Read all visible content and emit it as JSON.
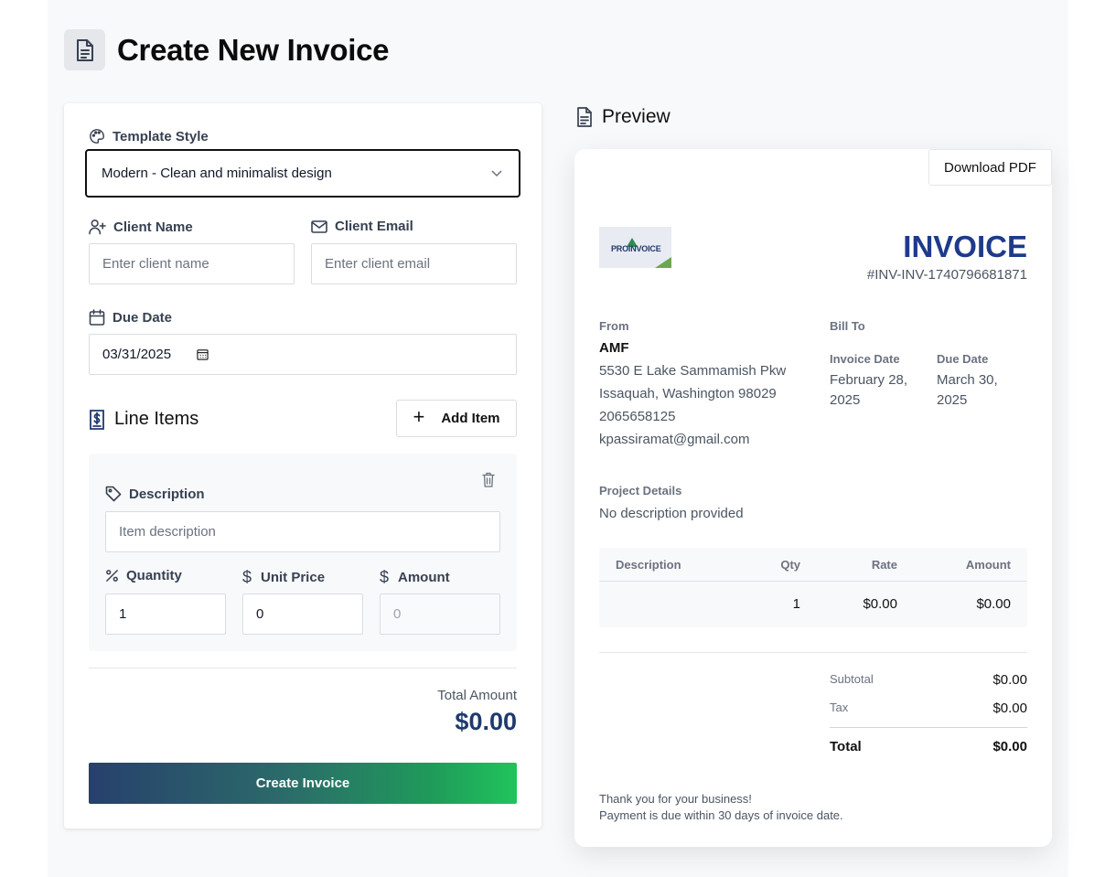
{
  "page": {
    "title": "Create New Invoice"
  },
  "form": {
    "template_style": {
      "label": "Template Style",
      "value": "Modern - Clean and minimalist design"
    },
    "client_name": {
      "label": "Client Name",
      "placeholder": "Enter client name"
    },
    "client_email": {
      "label": "Client Email",
      "placeholder": "Enter client email"
    },
    "due_date": {
      "label": "Due Date",
      "value": "03/31/2025"
    },
    "line_items": {
      "title": "Line Items",
      "add_label": "Add Item",
      "item": {
        "description_label": "Description",
        "description_placeholder": "Item description",
        "quantity_label": "Quantity",
        "quantity_value": "1",
        "unit_price_label": "Unit Price",
        "unit_price_value": "0",
        "amount_label": "Amount",
        "amount_value": "0"
      }
    },
    "total_label": "Total Amount",
    "total_value": "$0.00",
    "submit_label": "Create Invoice"
  },
  "preview": {
    "title": "Preview",
    "download_label": "Download PDF",
    "logo_text": "PROINVOICE",
    "invoice_title": "INVOICE",
    "invoice_number": "#INV-INV-1740796681871",
    "from_label": "From",
    "from_name": "AMF",
    "from_address1": "5530 E Lake Sammamish Pkw",
    "from_address2": "Issaquah, Washington 98029",
    "from_phone": "2065658125",
    "from_email": "kpassiramat@gmail.com",
    "bill_to_label": "Bill To",
    "invoice_date_label": "Invoice Date",
    "invoice_date_line1": "February 28,",
    "invoice_date_line2": "2025",
    "due_date_label": "Due Date",
    "due_date_line1": "March 30,",
    "due_date_line2": "2025",
    "project_label": "Project Details",
    "project_value": "No description provided",
    "table": {
      "headers": {
        "description": "Description",
        "qty": "Qty",
        "rate": "Rate",
        "amount": "Amount"
      },
      "rows": [
        {
          "description": "",
          "qty": "1",
          "rate": "$0.00",
          "amount": "$0.00"
        }
      ]
    },
    "subtotal_label": "Subtotal",
    "subtotal_value": "$0.00",
    "tax_label": "Tax",
    "tax_value": "$0.00",
    "total_label": "Total",
    "total_value": "$0.00",
    "footer_line1": "Thank you for your business!",
    "footer_line2": "Payment is due within 30 days of invoice date."
  },
  "colors": {
    "accent": "#1e3a8a",
    "gradient_start": "#27406c",
    "gradient_end": "#21c45c",
    "logo_green": "#6aa84f"
  },
  "icons": [
    "document-icon",
    "palette-icon",
    "user-plus-icon",
    "mail-icon",
    "calendar-icon",
    "receipt-icon",
    "plus-icon",
    "trash-icon",
    "tag-icon",
    "percent-icon",
    "dollar-icon",
    "chevron-down-icon"
  ]
}
